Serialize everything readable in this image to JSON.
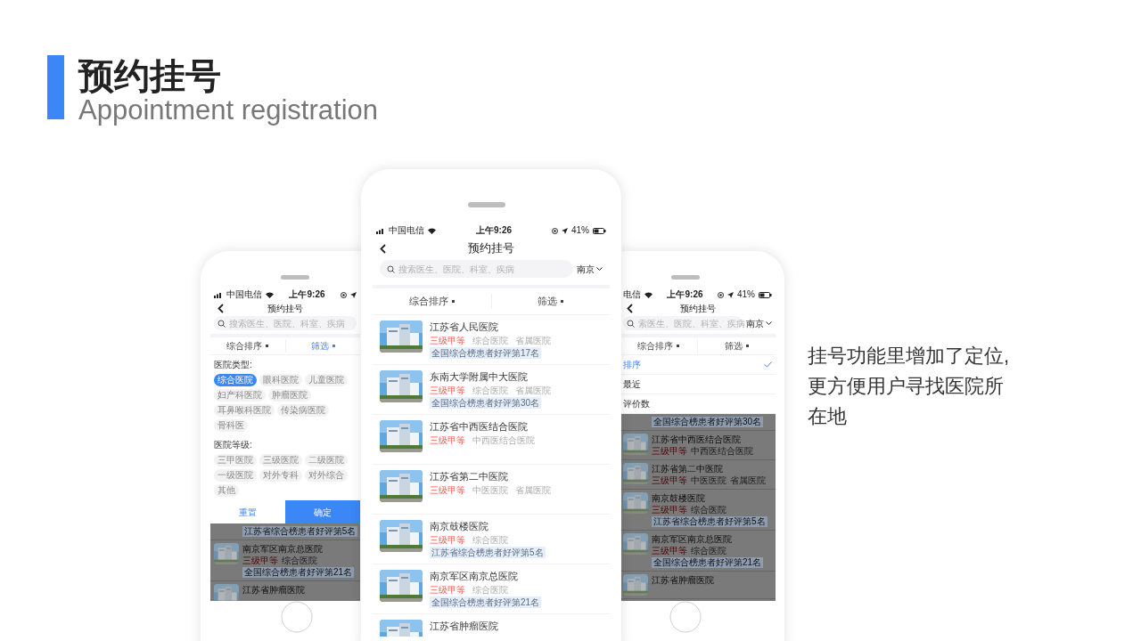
{
  "slide": {
    "title": "预约挂号",
    "subtitle": "Appointment registration",
    "note": "挂号功能里增加了定位,更方便用户寻找医院所在地"
  },
  "phones": [
    {
      "kind": "filter",
      "status": {
        "carrier": "中国电信",
        "time": "上午9:26"
      },
      "nav_title": "预约挂号",
      "search": {
        "placeholder": "搜索医生、医院、科室、疾病"
      },
      "sort_bar": [
        {
          "label": "综合排序",
          "selected": false
        },
        {
          "label": "筛选",
          "selected": true
        }
      ],
      "filter_groups": [
        {
          "label": "医院类型:",
          "options": [
            {
              "label": "综合医院",
              "selected": true
            },
            {
              "label": "眼科医院",
              "selected": false
            },
            {
              "label": "儿童医院",
              "selected": false
            },
            {
              "label": "妇产科医院",
              "selected": false
            },
            {
              "label": "肿瘤医院",
              "selected": false
            },
            {
              "label": "耳鼻喉科医院",
              "selected": false
            },
            {
              "label": "传染病医院",
              "selected": false
            },
            {
              "label": "骨科医",
              "selected": false
            }
          ]
        },
        {
          "label": "医院等级:",
          "options": [
            {
              "label": "三甲医院",
              "selected": false
            },
            {
              "label": "三级医院",
              "selected": false
            },
            {
              "label": "二级医院",
              "selected": false
            },
            {
              "label": "一级医院",
              "selected": false
            },
            {
              "label": "对外专科",
              "selected": false
            },
            {
              "label": "对外综合",
              "selected": false
            },
            {
              "label": "其他",
              "selected": false
            }
          ]
        }
      ],
      "buttons": [
        {
          "label": "重置",
          "kind": "secondary"
        },
        {
          "label": "确定",
          "kind": "primary"
        }
      ],
      "hospitals": [
        {
          "rank": "江苏省综合榜患者好评第5名"
        },
        {
          "name": "南京军区南京总医院",
          "grade": "三级甲等",
          "tags": [
            "综合医院"
          ],
          "rank": "全国综合榜患者好评第21名"
        },
        {
          "name": "江苏省肿瘤医院"
        }
      ]
    },
    {
      "kind": "list",
      "status": {
        "carrier": "中国电信",
        "time": "上午9:26",
        "battery": "41%"
      },
      "nav_title": "预约挂号",
      "search": {
        "placeholder": "搜索医生、医院、科室、疾病"
      },
      "city": "南京",
      "sort_bar": [
        {
          "label": "综合排序",
          "selected": false
        },
        {
          "label": "筛选",
          "selected": false
        }
      ],
      "hospitals": [
        {
          "name": "江苏省人民医院",
          "grade": "三级甲等",
          "tags": [
            "综合医院",
            "省属医院"
          ],
          "rank": "全国综合榜患者好评第17名"
        },
        {
          "name": "东南大学附属中大医院",
          "grade": "三级甲等",
          "tags": [
            "综合医院",
            "省属医院"
          ],
          "rank": "全国综合榜患者好评第30名"
        },
        {
          "name": "江苏省中西医结合医院",
          "grade": "三级甲等",
          "tags": [
            "中西医结合医院"
          ]
        },
        {
          "name": "江苏省第二中医院",
          "grade": "三级甲等",
          "tags": [
            "中医医院",
            "省属医院"
          ]
        },
        {
          "name": "南京鼓楼医院",
          "grade": "三级甲等",
          "tags": [
            "综合医院"
          ],
          "rank": "江苏省综合榜患者好评第5名"
        },
        {
          "name": "南京军区南京总医院",
          "grade": "三级甲等",
          "tags": [
            "综合医院"
          ],
          "rank": "全国综合榜患者好评第21名"
        },
        {
          "name": "江苏省肿瘤医院"
        }
      ]
    },
    {
      "kind": "sort",
      "status": {
        "carrier": "电信",
        "time": "上午9:26",
        "battery": "41%"
      },
      "nav_title": "预约挂号",
      "search": {
        "placeholder": "索医生、医院、科室、疾病"
      },
      "city": "南京",
      "sort_bar": [
        {
          "label": "综合排序",
          "selected": false
        },
        {
          "label": "筛选",
          "selected": false
        }
      ],
      "sort_options": [
        {
          "label": "排序",
          "selected": true
        },
        {
          "label": "最近",
          "selected": false
        },
        {
          "label": "评价数",
          "selected": false
        }
      ],
      "hospitals": [
        {
          "rank": "全国综合榜患者好评第30名"
        },
        {
          "name": "江苏省中西医结合医院",
          "grade": "三级甲等",
          "tags": [
            "中西医结合医院"
          ]
        },
        {
          "name": "江苏省第二中医院",
          "grade": "三级甲等",
          "tags": [
            "中医医院",
            "省属医院"
          ]
        },
        {
          "name": "南京鼓楼医院",
          "grade": "三级甲等",
          "tags": [
            "综合医院"
          ],
          "rank": "江苏省综合榜患者好评第5名"
        },
        {
          "name": "南京军区南京总医院",
          "grade": "三级甲等",
          "tags": [
            "综合医院"
          ],
          "rank": "全国综合榜患者好评第21名"
        },
        {
          "name": "江苏省肿瘤医院"
        }
      ]
    }
  ]
}
